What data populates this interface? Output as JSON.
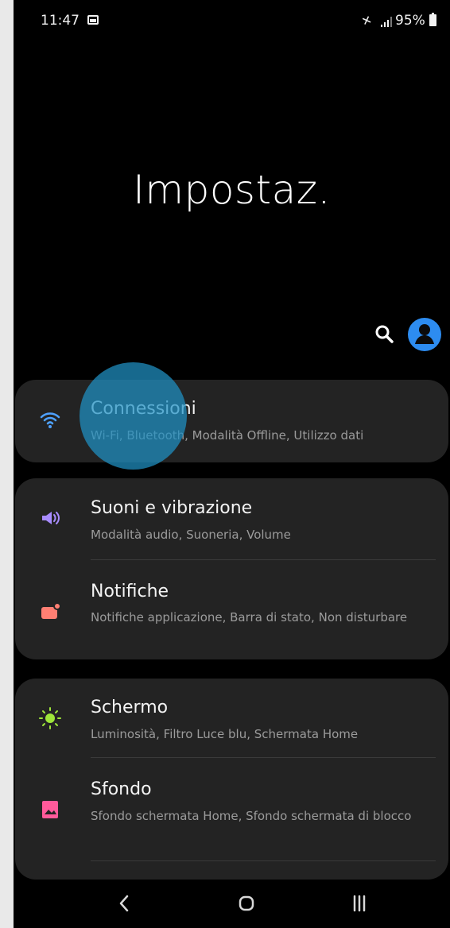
{
  "status_bar": {
    "time": "11:47",
    "battery": "95%",
    "icons": [
      "gallery-icon",
      "mute-icon",
      "signal-icon",
      "battery-icon"
    ]
  },
  "header": {
    "title": "Impostaz.",
    "actions": [
      "search-icon",
      "profile-icon"
    ]
  },
  "settings": [
    {
      "group": 1,
      "items": [
        {
          "title": "Connessioni",
          "subtitle": "Wi-Fi, Bluetooth, Modalità Offline, Utilizzo dati",
          "icon": "wifi-icon",
          "icon_color": "#4ea1ff"
        }
      ]
    },
    {
      "group": 2,
      "items": [
        {
          "title": "Suoni e vibrazione",
          "subtitle": "Modalità audio, Suoneria, Volume",
          "icon": "volume-icon",
          "icon_color": "#a88cff"
        },
        {
          "title": "Notifiche",
          "subtitle": "Notifiche applicazione, Barra di stato, Non disturbare",
          "icon": "notification-icon",
          "icon_color": "#ff7f73"
        }
      ]
    },
    {
      "group": 3,
      "items": [
        {
          "title": "Schermo",
          "subtitle": "Luminosità, Filtro Luce blu, Schermata Home",
          "icon": "brightness-icon",
          "icon_color": "#9ee53a"
        },
        {
          "title": "Sfondo",
          "subtitle": "Sfondo schermata Home, Sfondo schermata di blocco",
          "icon": "wallpaper-icon",
          "icon_color": "#ff5a9a"
        }
      ]
    }
  ],
  "navigation": {
    "buttons": [
      "back-icon",
      "home-icon",
      "recent-apps-icon"
    ]
  },
  "colors": {
    "background": "#000000",
    "card": "#232323",
    "accent": "#2092c5",
    "text_primary": "#f3f3f3",
    "text_secondary": "#9b9b9b"
  }
}
